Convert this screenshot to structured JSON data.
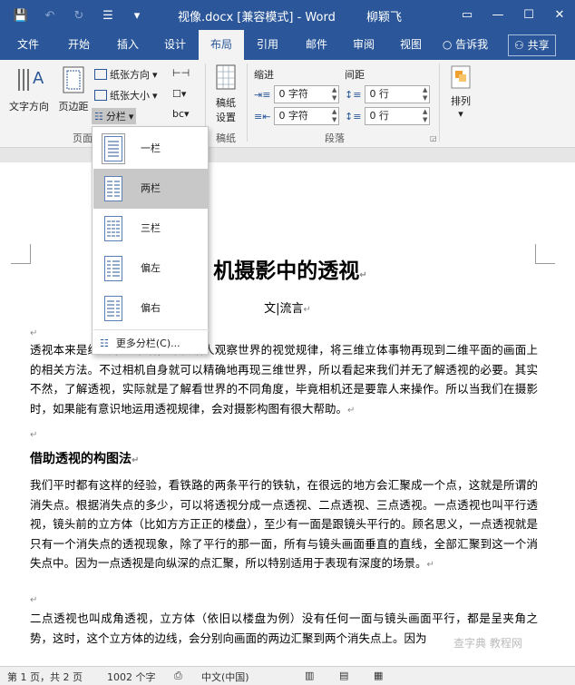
{
  "titlebar": {
    "title": "视像.docx [兼容模式] - Word",
    "user": "柳颖飞",
    "icons": [
      "save-icon",
      "undo-icon",
      "redo-icon",
      "touch-mode-icon",
      "customize-icon"
    ],
    "win": {
      "restore": "▭",
      "minimize": "—",
      "maximize": "☐",
      "close": "✕"
    }
  },
  "tabs": [
    "文件",
    "开始",
    "插入",
    "设计",
    "布局",
    "引用",
    "邮件",
    "审阅",
    "视图",
    "告诉我",
    "共享"
  ],
  "ribbon": {
    "text_direction": "文字方向",
    "margins": "页边距",
    "orientation": "纸张方向",
    "size": "纸张大小",
    "columns": "分栏",
    "page_setup_group": "页面",
    "manuscript": "稿纸",
    "manuscript_setup": "设置",
    "manuscript_group": "稿纸",
    "indent_label": "缩进",
    "spacing_label": "间距",
    "indent_left": "0 字符",
    "indent_right": "0 字符",
    "spacing_before": "0 行",
    "spacing_after": "0 行",
    "paragraph_group": "段落",
    "arrange": "排列"
  },
  "columns_menu": {
    "items": [
      "一栏",
      "两栏",
      "三栏",
      "偏左",
      "偏右"
    ],
    "more": "更多分栏(C)..."
  },
  "doc": {
    "heading": "机摄影中的透视",
    "author": "文|流言",
    "p1": "透视本来是绘画中的术语，即根据人观察世界的视觉规律，将三维立体事物再现到二维平面的画面上的相关方法。不过相机自身就可以精确地再现三维世界，所以看起来我们并无了解透视的必要。其实不然，了解透视，实际就是了解看世界的不同角度，毕竟相机还是要靠人来操作。所以当我们在摄影时，如果能有意识地运用透视规律，会对摄影构图有很大帮助。",
    "h2": "借助透视的构图法",
    "p2": "我们平时都有这样的经验，看铁路的两条平行的铁轨，在很远的地方会汇聚成一个点，这就是所谓的消失点。根据消失点的多少，可以将透视分成一点透视、二点透视、三点透视。一点透视也叫平行透视，镜头前的立方体（比如方方正正的楼盘），至少有一面是跟镜头平行的。顾名思义，一点透视就是只有一个消失点的透视现象，除了平行的那一面，所有与镜头画面垂直的直线，全部汇聚到这一个消失点中。因为一点透视是向纵深的点汇聚，所以特别适用于表现有深度的场景。",
    "p3": "二点透视也叫成角透视，立方体（依旧以楼盘为例）没有任何一面与镜头画面平行，都是呈夹角之势，这时，这个立方体的边线，会分别向画面的两边汇聚到两个消失点上。因为"
  },
  "status": {
    "page": "第 1 页，共 2 页",
    "words": "1002 个字",
    "lang": "中文(中国)"
  },
  "watermark": "查字典 教程网"
}
